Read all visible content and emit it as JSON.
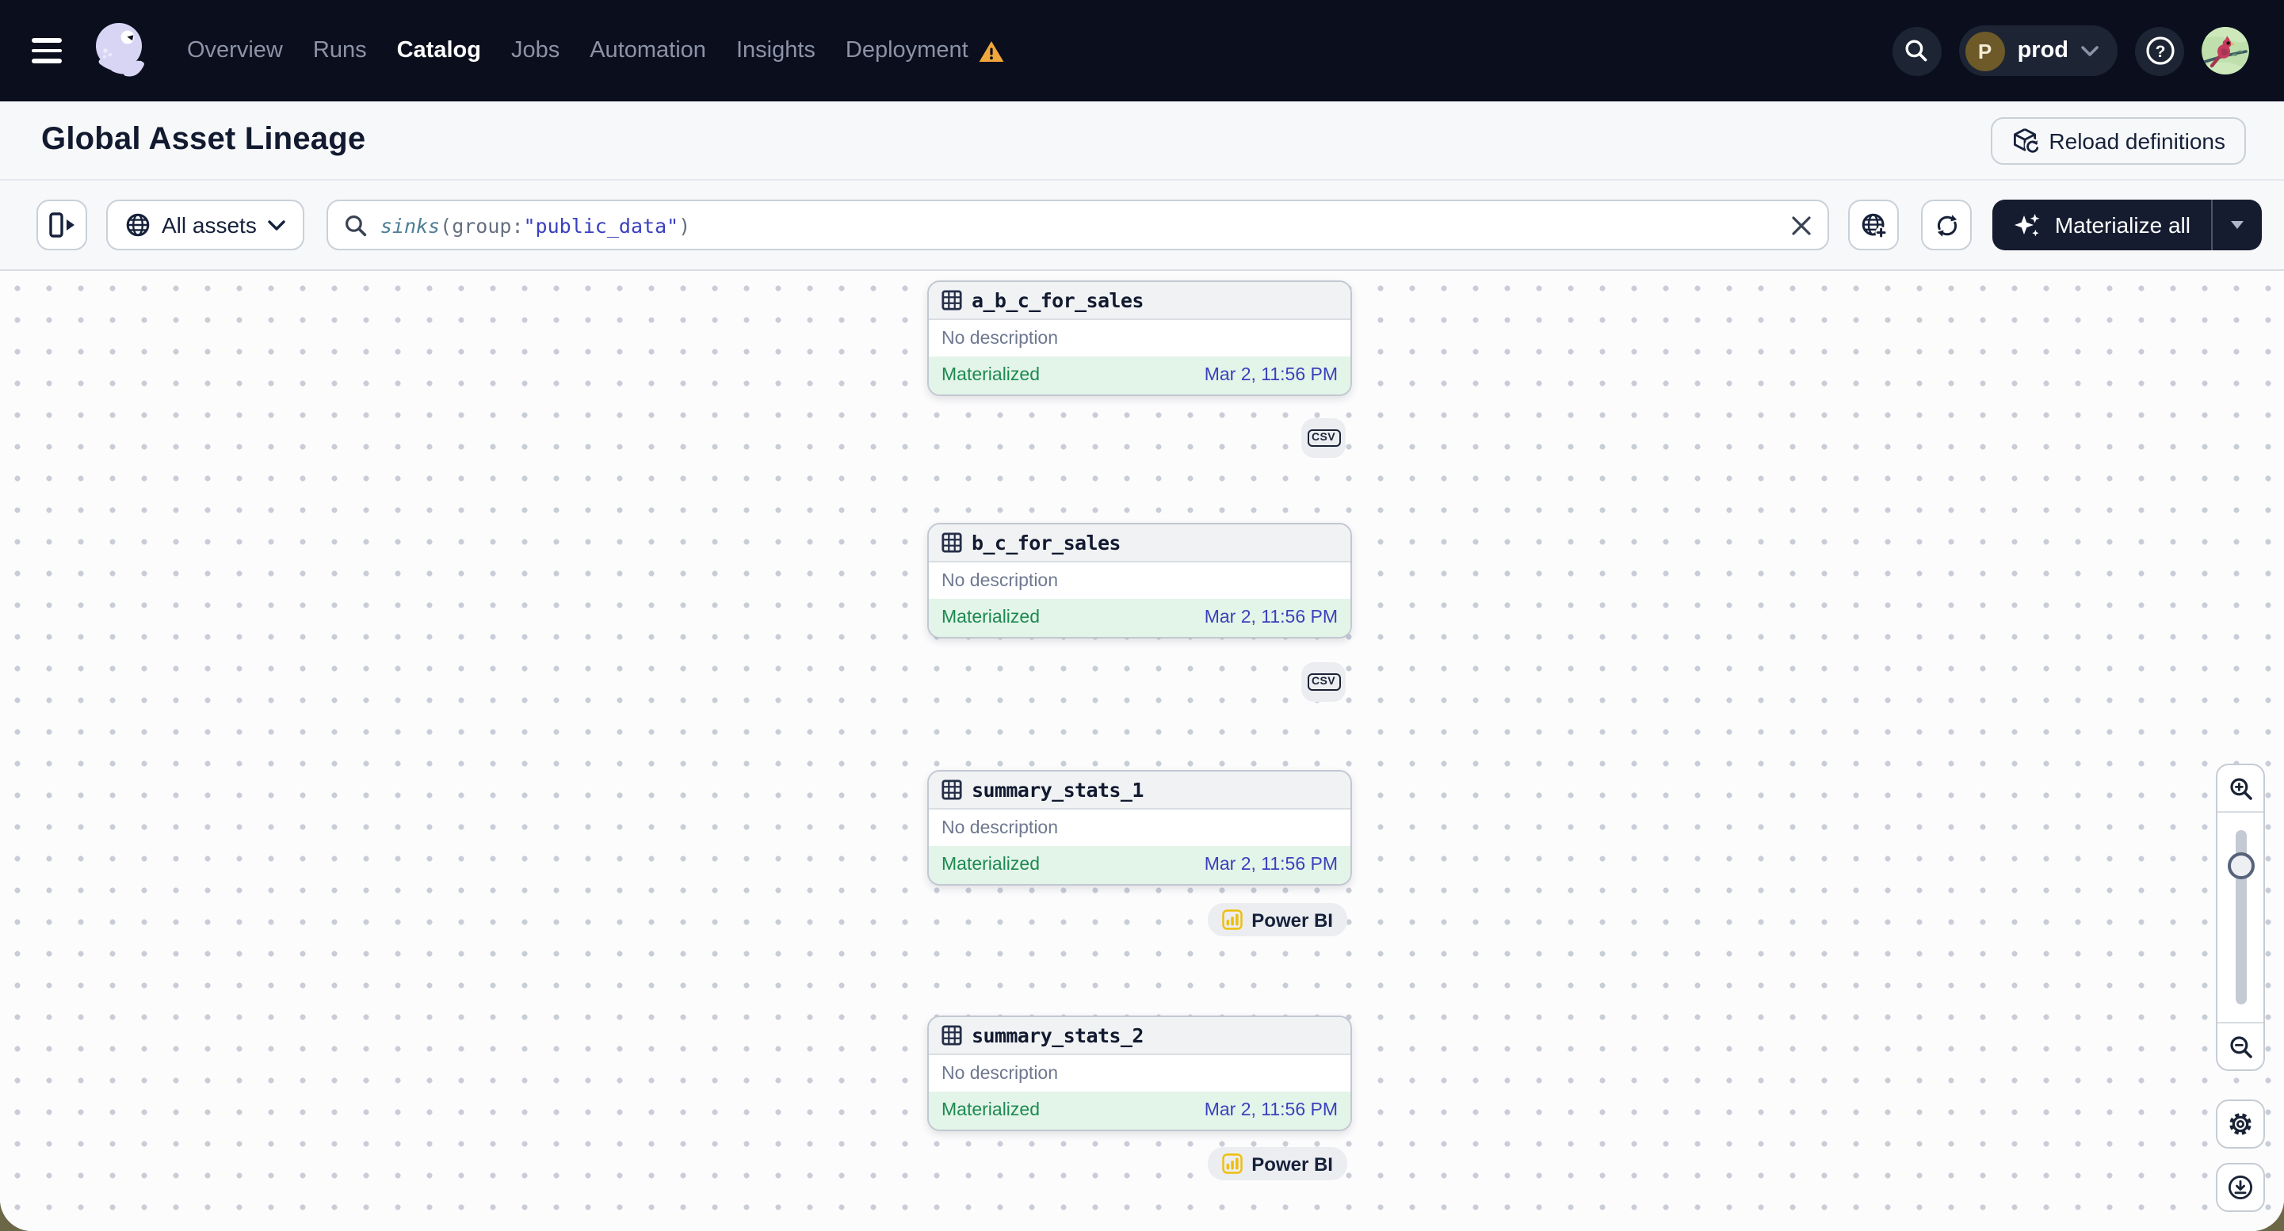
{
  "nav": {
    "items": [
      "Overview",
      "Runs",
      "Catalog",
      "Jobs",
      "Automation",
      "Insights",
      "Deployment"
    ],
    "active_item": "Catalog",
    "deployment_has_warning": true,
    "environment": {
      "initial": "P",
      "name": "prod"
    }
  },
  "header": {
    "title": "Global Asset Lineage",
    "reload_button": "Reload definitions"
  },
  "toolbar": {
    "filter_button": "All assets",
    "search": {
      "fn": "sinks",
      "open": "(",
      "field": "group:",
      "value": "\"public_data\"",
      "close": ")"
    },
    "materialize_button": "Materialize all"
  },
  "graph": {
    "assets": [
      {
        "name": "a_b_c_for_sales",
        "description": "No description",
        "status": "Materialized",
        "timestamp": "Mar 2, 11:56 PM",
        "kind_tag": "csv"
      },
      {
        "name": "b_c_for_sales",
        "description": "No description",
        "status": "Materialized",
        "timestamp": "Mar 2, 11:56 PM",
        "kind_tag": "csv"
      },
      {
        "name": "summary_stats_1",
        "description": "No description",
        "status": "Materialized",
        "timestamp": "Mar 2, 11:56 PM",
        "kind_tag": "Power BI"
      },
      {
        "name": "summary_stats_2",
        "description": "No description",
        "status": "Materialized",
        "timestamp": "Mar 2, 11:56 PM",
        "kind_tag": "Power BI"
      }
    ]
  },
  "icons": {
    "nav": [
      "hamburger-icon",
      "dagster-logo",
      "warning-triangle-icon",
      "search-icon",
      "chevron-down-icon",
      "help-icon",
      "avatar"
    ],
    "toolbar": [
      "panel-open-icon",
      "globe-icon",
      "search-icon",
      "clear-icon",
      "globe-add-icon",
      "refresh-icon",
      "sparkles-icon",
      "caret-down-icon"
    ],
    "graph": [
      "table-icon",
      "csv-file-icon",
      "powerbi-icon",
      "zoom-in-icon",
      "zoom-out-icon",
      "gear-icon",
      "download-icon"
    ]
  },
  "colors": {
    "nav_bg": "#0A0E1D",
    "warning": "#F1A73B",
    "status_green": "#1D8A50",
    "status_green_bg": "#E3F4E9",
    "timestamp_blue": "#3B41BC",
    "query_fn": "#4E7E95",
    "query_string": "#3A40BE",
    "powerbi_yellow": "#EFBE0C",
    "dark_button": "#151C30",
    "corner_olive": "#6B6747"
  }
}
